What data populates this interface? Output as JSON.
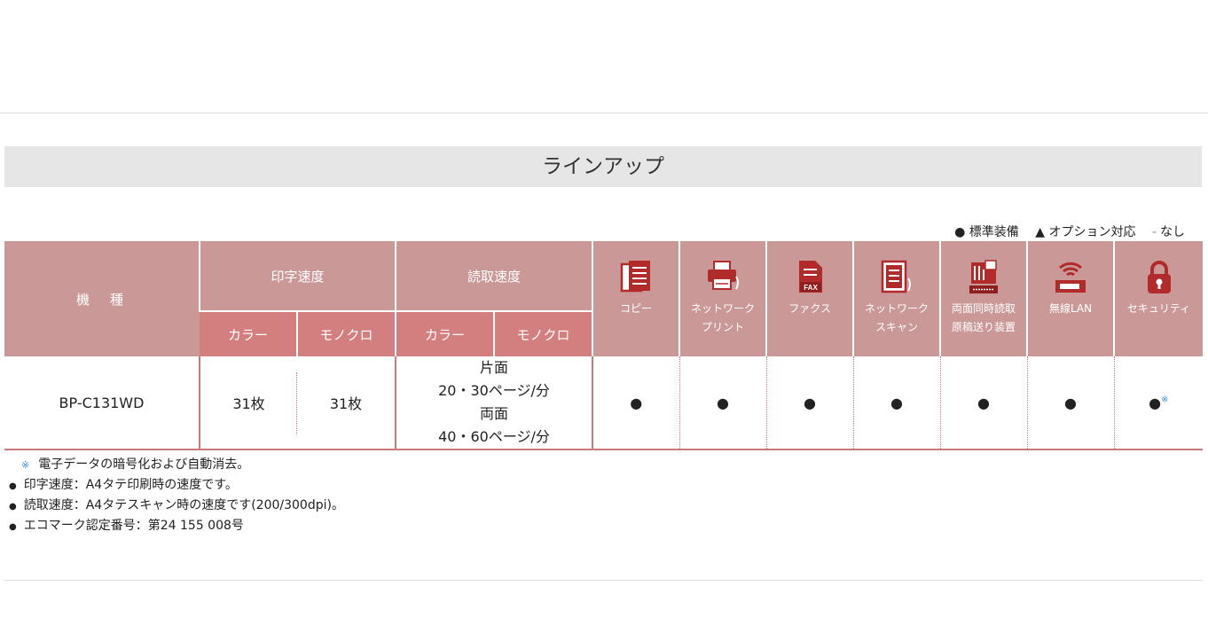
{
  "section_title": "ラインアップ",
  "legend": {
    "standard": "● 標準装備",
    "option": "▲ オプション対応",
    "none_mark": "-",
    "none_label": "なし"
  },
  "table": {
    "header": {
      "model": "機　種",
      "print_speed": "印字速度",
      "read_speed": "読取速度",
      "color": "カラー",
      "mono": "モノクロ",
      "features": [
        {
          "icon": "copy-icon",
          "line1": "コピー",
          "line2": ""
        },
        {
          "icon": "network-print-icon",
          "line1": "ネットワーク",
          "line2": "プリント"
        },
        {
          "icon": "fax-icon",
          "line1": "ファクス",
          "line2": ""
        },
        {
          "icon": "network-scan-icon",
          "line1": "ネットワーク",
          "line2": "スキャン"
        },
        {
          "icon": "duplex-scan-feeder-icon",
          "line1": "両面同時読取",
          "line2": "原稿送り装置"
        },
        {
          "icon": "wireless-lan-icon",
          "line1": "無線LAN",
          "line2": ""
        },
        {
          "icon": "security-lock-icon",
          "line1": "セキュリティ",
          "line2": ""
        }
      ]
    },
    "row": {
      "model": "BP-C131WD",
      "print_color": "31枚",
      "print_mono": "31枚",
      "read_line1": "片面",
      "read_line2": "20・30ページ/分",
      "read_line3": "両面",
      "read_line4": "40・60ページ/分",
      "features": [
        "●",
        "●",
        "●",
        "●",
        "●",
        "●",
        "●"
      ],
      "security_note_mark": "※"
    }
  },
  "notes": {
    "asterisk_mark": "※",
    "asterisk": "電子データの暗号化および自動消去。",
    "items": [
      "印字速度：A4タテ印刷時の速度です。",
      "読取速度：A4タテスキャン時の速度です(200/300dpi)。",
      "エコマーク認定番号：第24 155 008号"
    ],
    "bullet": "●"
  },
  "colors": {
    "header_bg": "#cb9898",
    "sub_header_bg": "#d37f7f",
    "border": "#c77a7a",
    "icon_red": "#b22b2b",
    "note_blue": "#3b8fd4",
    "title_bg": "#e6e6e6"
  }
}
